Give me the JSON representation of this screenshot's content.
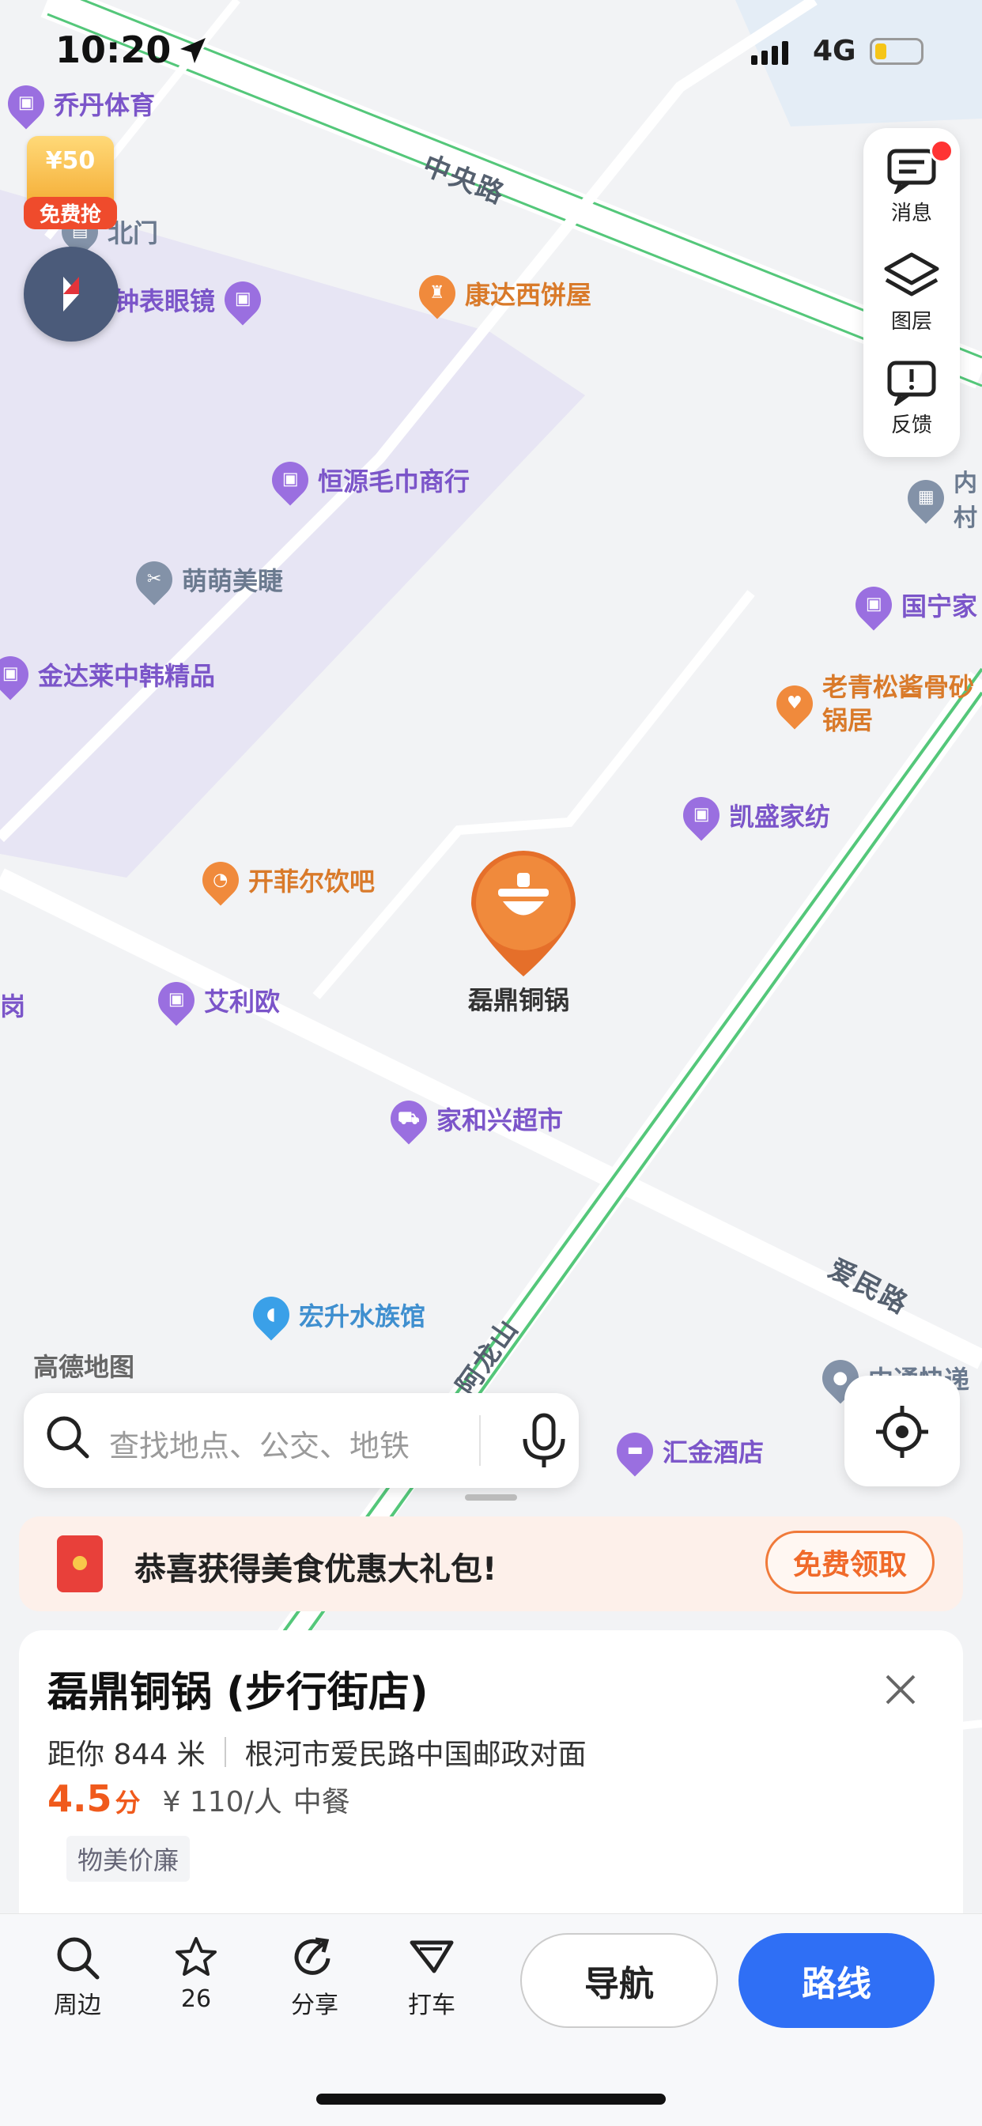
{
  "status_bar": {
    "time": "10:20",
    "network": "4G"
  },
  "map": {
    "road_labels": [
      "中央路",
      "爱民路",
      "阿龙山"
    ],
    "pois": [
      {
        "name": "乔丹体育",
        "style": "purple",
        "icon": "shop-icon"
      },
      {
        "name": "北门",
        "style": "gray",
        "icon": "gate-icon"
      },
      {
        "name": "大明钟表眼镜",
        "style": "purple",
        "icon": "shop-icon"
      },
      {
        "name": "康达西饼屋",
        "style": "orange",
        "icon": "bakery-icon"
      },
      {
        "name": "恒源毛巾商行",
        "style": "purple",
        "icon": "shop-icon"
      },
      {
        "name": "内村",
        "style": "gray",
        "icon": "bank-icon"
      },
      {
        "name": "萌萌美睫",
        "style": "gray",
        "icon": "scissors-icon"
      },
      {
        "name": "国宁家",
        "style": "purple",
        "icon": "shop-icon"
      },
      {
        "name": "金达莱中韩精品",
        "style": "purple",
        "icon": "shop-icon"
      },
      {
        "name": "老青松酱骨砂锅居",
        "style": "orange",
        "icon": "restaurant-icon"
      },
      {
        "name": "凯盛家纺",
        "style": "purple",
        "icon": "shop-icon"
      },
      {
        "name": "开菲尔饮吧",
        "style": "orange",
        "icon": "drink-icon"
      },
      {
        "name": "艾利欧",
        "style": "purple",
        "icon": "shop-icon"
      },
      {
        "name": "岗",
        "style": "purple",
        "icon": ""
      },
      {
        "name": "家和兴超市",
        "style": "purple",
        "icon": "cart-icon"
      },
      {
        "name": "宏升水族馆",
        "style": "blue",
        "icon": "dolphin-icon"
      },
      {
        "name": "汇金酒店",
        "style": "purple",
        "icon": "hotel-icon"
      },
      {
        "name": "中通快递",
        "style": "gray",
        "icon": "location-icon"
      }
    ],
    "selected_poi": "磊鼎铜锅",
    "logo_text": "高德地图",
    "coupon": {
      "amount": "¥50",
      "label": "免费抢"
    }
  },
  "toolbar": [
    {
      "label": "消息",
      "icon": "message-icon"
    },
    {
      "label": "图层",
      "icon": "layers-icon"
    },
    {
      "label": "反馈",
      "icon": "feedback-icon"
    }
  ],
  "search": {
    "placeholder": "查找地点、公交、地铁"
  },
  "promo": {
    "text": "恭喜获得美食优惠大礼包!",
    "button": "免费领取"
  },
  "place_card": {
    "title": "磊鼎铜锅 (步行街店)",
    "distance": "距你 844 米",
    "address": "根河市爱民路中国邮政对面",
    "rating": "4.5",
    "rating_unit": "分",
    "price": "¥ 110/人",
    "cuisine": "中餐",
    "tag": "物美价廉"
  },
  "bottom_bar": {
    "items": [
      {
        "label": "周边",
        "icon": "search-icon"
      },
      {
        "label": "26",
        "icon": "star-icon"
      },
      {
        "label": "分享",
        "icon": "share-icon"
      },
      {
        "label": "打车",
        "icon": "taxi-icon"
      }
    ],
    "navigate": "导航",
    "route": "路线"
  }
}
